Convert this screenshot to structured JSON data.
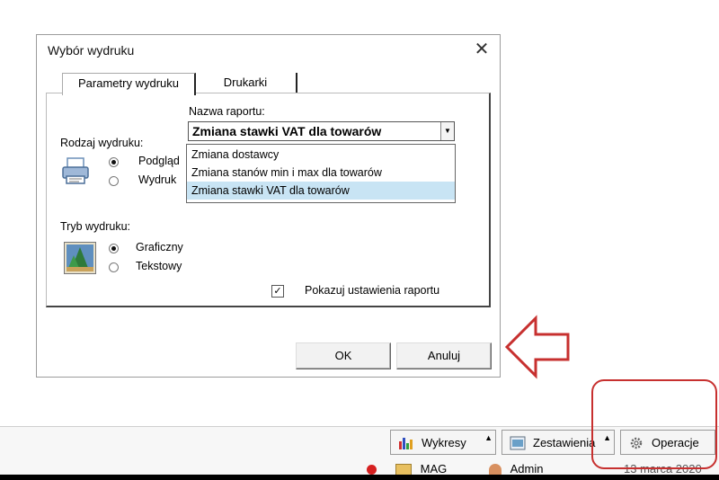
{
  "dialog": {
    "title": "Wybór wydruku",
    "close_glyph": "✕",
    "tabs": [
      {
        "label": "Parametry wydruku",
        "active": true
      },
      {
        "label": "Drukarki",
        "active": false
      }
    ],
    "report_name_label": "Nazwa raportu:",
    "report_selected": "Zmiana stawki VAT dla towarów",
    "report_options": [
      "Zmiana dostawcy",
      "Zmiana stanów min i max dla towarów",
      "Zmiana stawki VAT dla towarów"
    ],
    "print_kind": {
      "label": "Rodzaj wydruku:",
      "options": [
        {
          "label": "Podgląd",
          "checked": true
        },
        {
          "label": "Wydruk",
          "checked": false
        }
      ]
    },
    "print_mode": {
      "label": "Tryb wydruku:",
      "options": [
        {
          "label": "Graficzny",
          "checked": true
        },
        {
          "label": "Tekstowy",
          "checked": false
        }
      ]
    },
    "show_settings": {
      "label": "Pokazuj ustawienia raportu",
      "checked": true
    },
    "ok_label": "OK",
    "cancel_label": "Anuluj"
  },
  "taskbar": {
    "buttons": [
      {
        "label": "Wykresy",
        "icon": "bar-chart-icon"
      },
      {
        "label": "Zestawienia",
        "icon": "report-icon"
      },
      {
        "label": "Operacje",
        "icon": "gear-icon"
      }
    ],
    "status": {
      "module": "MAG",
      "user": "Admin",
      "date": "13 marca 2020"
    }
  },
  "annotations": {
    "color": "#c7302f"
  }
}
